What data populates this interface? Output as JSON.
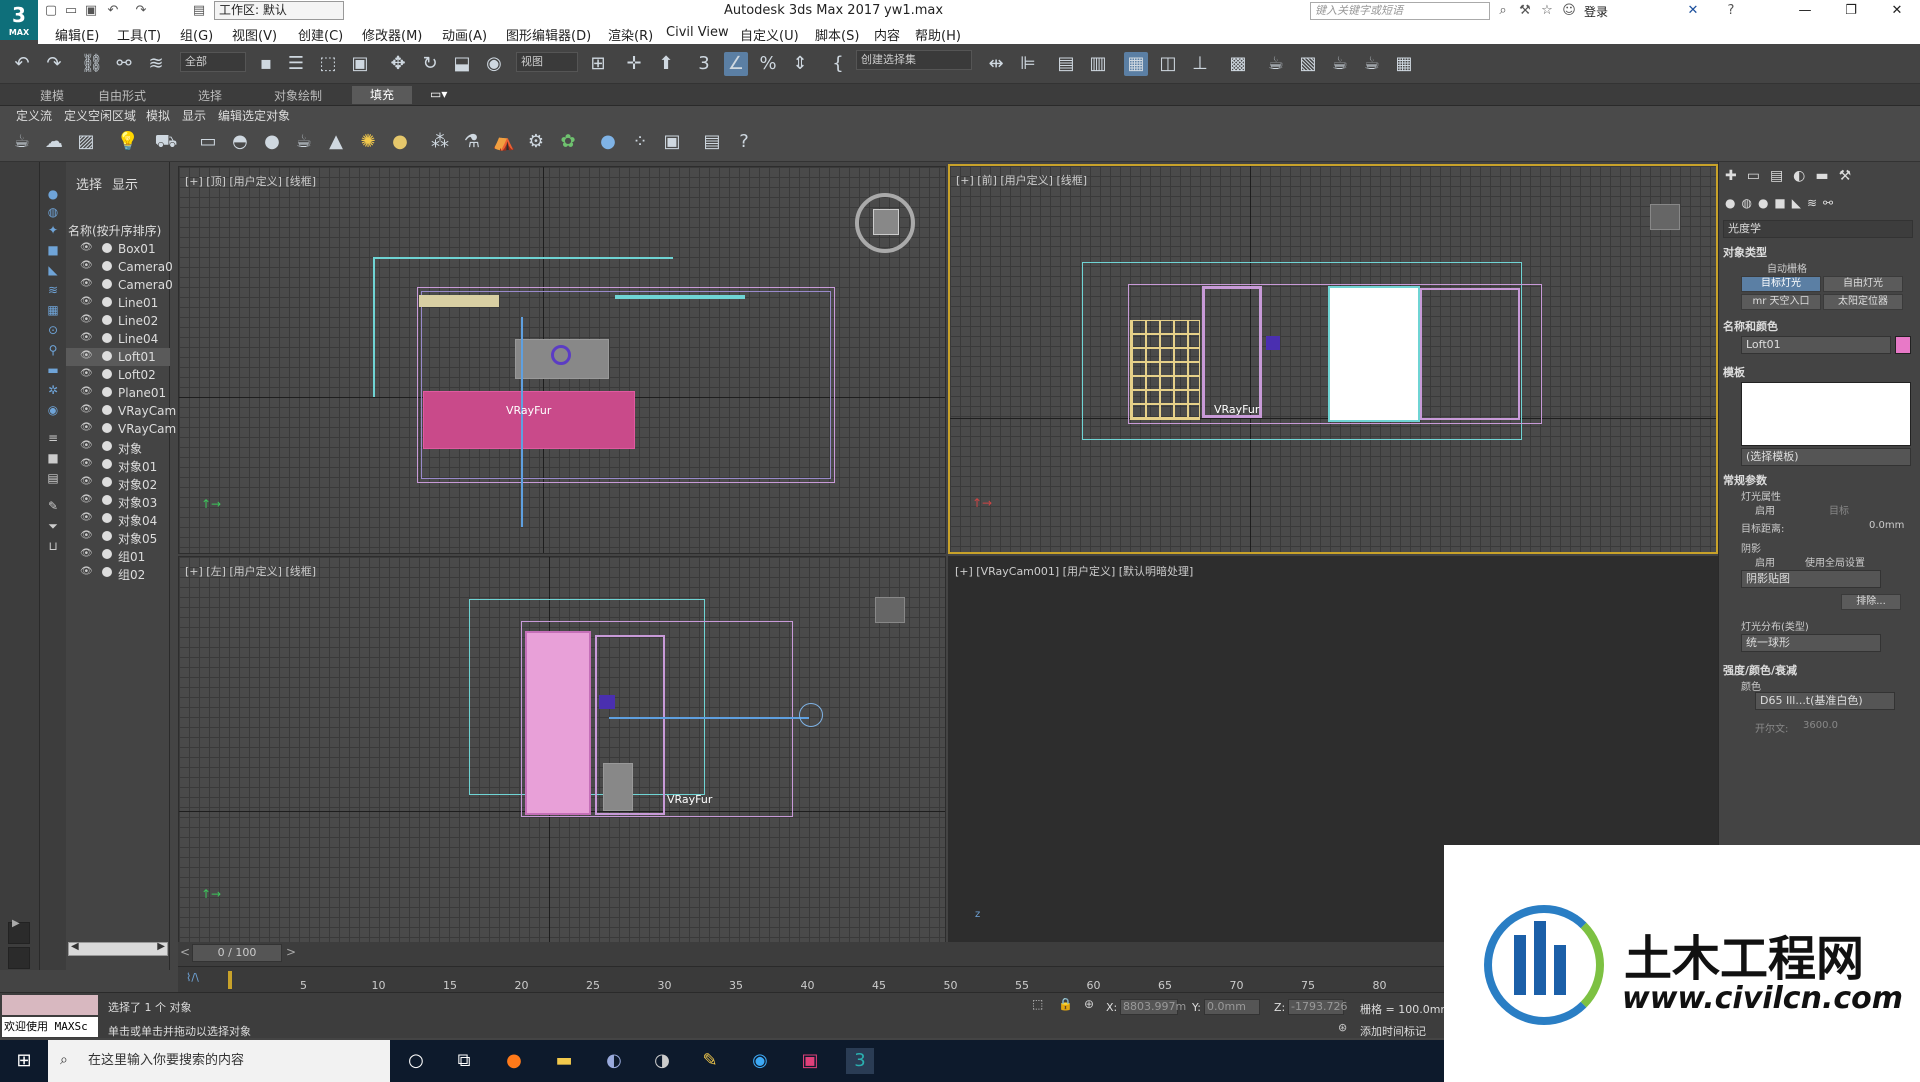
{
  "app": {
    "logo": "3",
    "logo_sub": "MAX",
    "workspace": "工作区: 默认",
    "title": "Autodesk 3ds Max 2017",
    "file": "yw1.max",
    "search_placeholder": "键入关键字或短语",
    "login": "登录"
  },
  "menu": [
    "编辑(E)",
    "工具(T)",
    "组(G)",
    "视图(V)",
    "创建(C)",
    "修改器(M)",
    "动画(A)",
    "图形编辑器(D)",
    "渲染(R)",
    "Civil View",
    "自定义(U)",
    "脚本(S)",
    "内容",
    "帮助(H)"
  ],
  "toolbar": {
    "filter": "全部",
    "ref_coord": "视图",
    "selection_set": "创建选择集"
  },
  "ribbon": {
    "tabs": [
      "建模",
      "自由形式",
      "选择",
      "对象绘制",
      "填充"
    ],
    "active": "填充",
    "subtabs": [
      "定义流",
      "定义空闲区域",
      "模拟",
      "显示",
      "编辑选定对象"
    ]
  },
  "scene_explorer": {
    "tabs": [
      "选择",
      "显示"
    ],
    "header": "名称(按升序排序)",
    "items": [
      "Box01",
      "Camera0",
      "Camera0",
      "Line01",
      "Line02",
      "Line04",
      "Loft01",
      "Loft02",
      "Plane01",
      "VRayCam",
      "VRayCam",
      "对象",
      "对象01",
      "对象02",
      "对象03",
      "对象04",
      "对象05",
      "组01",
      "组02"
    ],
    "selected": "Loft01"
  },
  "viewports": {
    "top": "[+] [顶] [用户定义] [线框]",
    "front": "[+] [前] [用户定义] [线框]",
    "left": "[+] [左] [用户定义] [线框]",
    "camera": "[+] [VRayCam001] [用户定义] [默认明暗处理]",
    "fur_label": "VRayFur"
  },
  "command_panel": {
    "category": "光度学",
    "object_type": "对象类型",
    "auto_grid": "自动栅格",
    "btn_target": "目标灯光",
    "btn_free": "自由灯光",
    "btn_mr": "mr 天空入口",
    "btn_sun": "太阳定位器",
    "name_color": "名称和颜色",
    "object_name": "Loft01",
    "object_color": "#e879c7",
    "template": "模板",
    "template_select": "(选择模板)",
    "general": "常规参数",
    "light_props": "灯光属性",
    "enabled": "启用",
    "target": "目标",
    "target_dist_label": "目标距离:",
    "target_dist": "0.0mm",
    "shadows": "阴影",
    "shadow_enabled": "启用",
    "global": "使用全局设置",
    "shadow_type": "阴影贴图",
    "exclude": "排除...",
    "distribution": "灯光分布(类型)",
    "distribution_value": "统一球形",
    "intensity": "强度/颜色/衰减",
    "color_label": "颜色",
    "color_value": "D65 Ill...t(基准白色)",
    "kelvin_label": "开尔文:",
    "kelvin": "3600.0"
  },
  "timeline": {
    "frame": "0 / 100",
    "ticks": [
      "5",
      "10",
      "15",
      "20",
      "25",
      "30",
      "35",
      "40",
      "45",
      "50",
      "55",
      "60",
      "65",
      "70",
      "75",
      "80"
    ]
  },
  "status": {
    "maxscript": "欢迎使用 MAXSc",
    "selected": "选择了 1 个 对象",
    "hint": "单击或单击并拖动以选择对象",
    "x_label": "X:",
    "x": "8803.997m",
    "y_label": "Y:",
    "y": "0.0mm",
    "z_label": "Z:",
    "z": "-1793.726",
    "grid": "栅格 = 100.0mm",
    "add_tag": "添加时间标记"
  },
  "taskbar": {
    "search": "在这里输入你要搜索的内容"
  },
  "watermark": {
    "brand": "土木工程网",
    "url": "www.civilcn.com"
  }
}
